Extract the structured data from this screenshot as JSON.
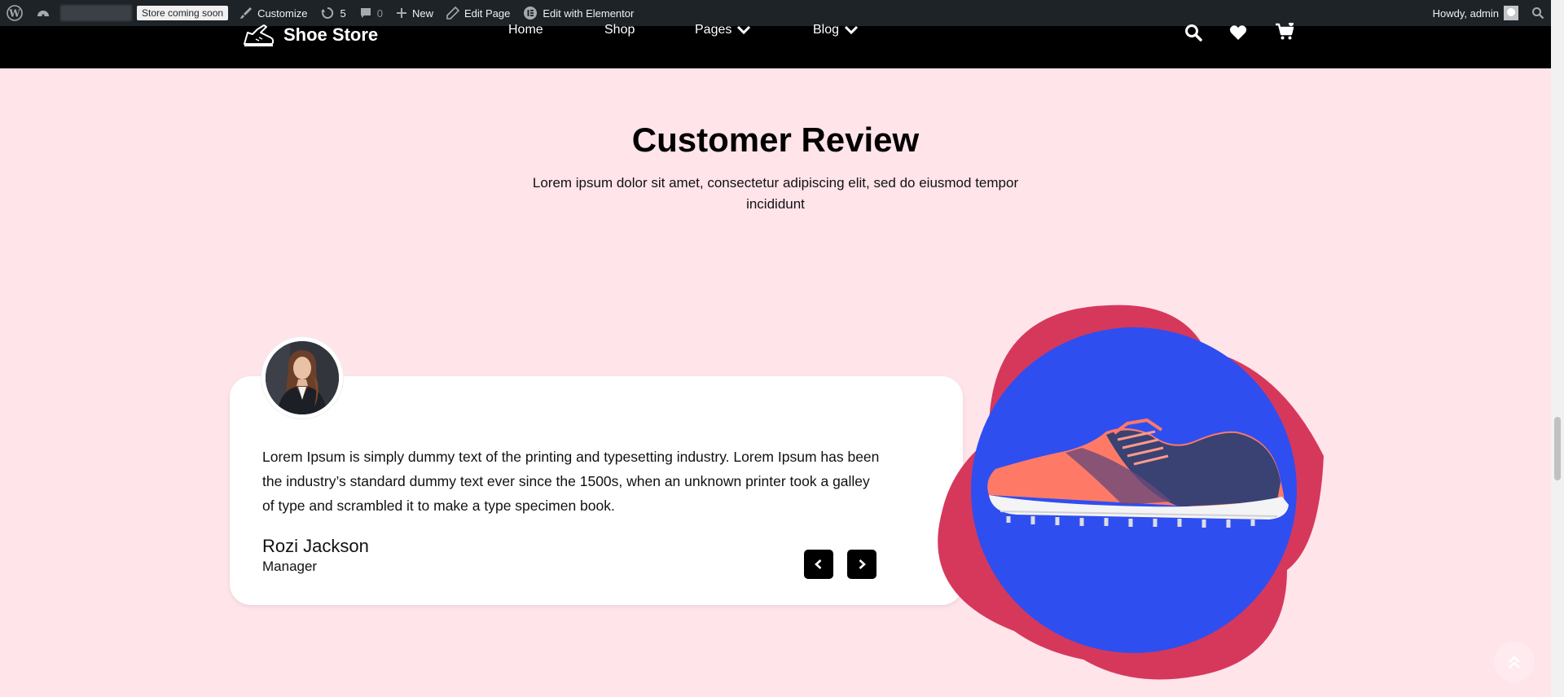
{
  "admin_bar": {
    "coming_soon": "Store coming soon",
    "customize": "Customize",
    "updates_count": "5",
    "comments_count": "0",
    "new": "New",
    "edit_page": "Edit Page",
    "edit_elementor": "Edit with Elementor",
    "howdy": "Howdy, admin"
  },
  "header": {
    "logo_text": "Shoe Store",
    "nav": {
      "home": "Home",
      "shop": "Shop",
      "pages": "Pages",
      "blog": "Blog"
    }
  },
  "section": {
    "title": "Customer Review",
    "subtitle": "Lorem ipsum dolor sit amet, consectetur adipiscing elit, sed do eiusmod tempor incididunt"
  },
  "review": {
    "text": "Lorem Ipsum is simply dummy text of the printing and typesetting industry. Lorem Ipsum has been the industry’s standard dummy text ever since the 1500s, when an unknown printer took a galley of type and scrambled it to make a type specimen book.",
    "name": "Rozi Jackson",
    "role": "Manager"
  },
  "colors": {
    "page_bg": "#ffe4ea",
    "header_bg": "#000000",
    "blob_outer": "#d6385c",
    "blob_inner": "#2f4ef0"
  }
}
